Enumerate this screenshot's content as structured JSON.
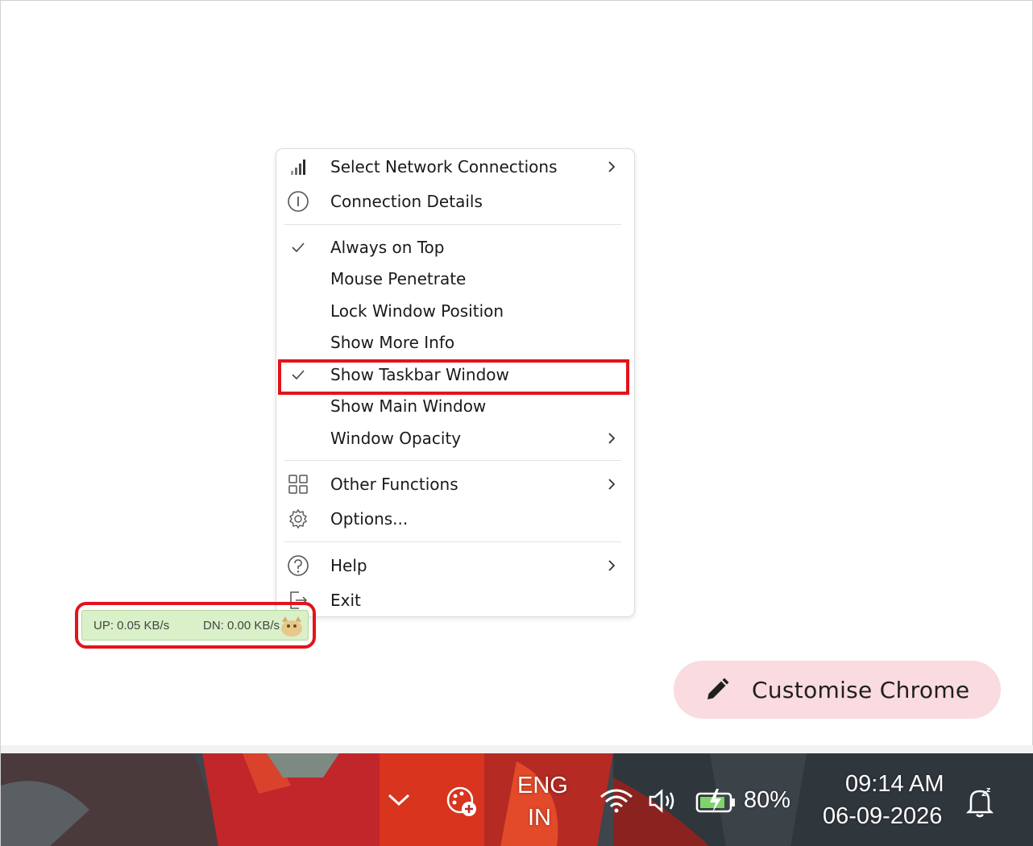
{
  "menu": {
    "items": [
      {
        "label": "Select Network Connections",
        "icon": "signal-bars-icon",
        "submenu": true
      },
      {
        "label": "Connection Details",
        "icon": "info-icon",
        "submenu": false
      },
      {
        "label": "Always on Top",
        "checked": true
      },
      {
        "label": "Mouse Penetrate",
        "checked": false
      },
      {
        "label": "Lock Window Position",
        "checked": false
      },
      {
        "label": "Show More Info",
        "checked": false
      },
      {
        "label": "Show Taskbar Window",
        "checked": true,
        "highlighted": true
      },
      {
        "label": "Show Main Window",
        "checked": false
      },
      {
        "label": "Window Opacity",
        "submenu": true
      },
      {
        "label": "Other Functions",
        "icon": "grid-icon",
        "submenu": true
      },
      {
        "label": "Options...",
        "icon": "gear-icon",
        "submenu": false
      },
      {
        "label": "Help",
        "icon": "help-icon",
        "submenu": true
      },
      {
        "label": "Exit",
        "icon": "exit-icon",
        "submenu": false
      }
    ]
  },
  "speed_widget": {
    "up": "UP: 0.05 KB/s",
    "down": "DN: 0.00 KB/s"
  },
  "customise_chrome": {
    "label": "Customise Chrome",
    "icon": "pencil-icon"
  },
  "taskbar": {
    "language_line1": "ENG",
    "language_line2": "IN",
    "battery": "80%",
    "time": "09:14 AM",
    "date": "06-09-2026"
  },
  "colors": {
    "highlight_red": "#e3131b",
    "widget_green": "#d9f0c8",
    "chrome_pink": "#f9dbe0"
  }
}
